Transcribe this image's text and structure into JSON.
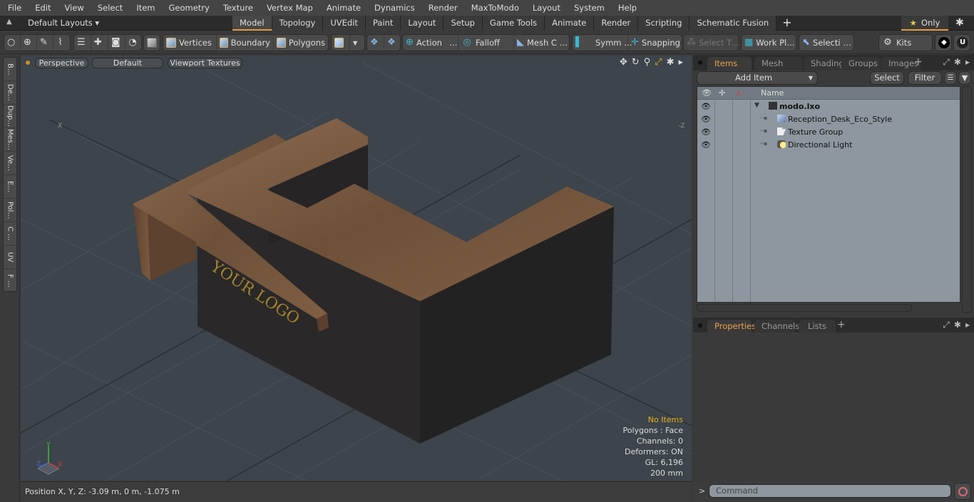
{
  "menu": [
    "File",
    "Edit",
    "View",
    "Select",
    "Item",
    "Geometry",
    "Texture",
    "Vertex Map",
    "Animate",
    "Dynamics",
    "Render",
    "MaxToModo",
    "Layout",
    "System",
    "Help"
  ],
  "layoutbar": {
    "layouts_label": "Default Layouts ▾",
    "tabs": [
      {
        "label": "Model",
        "active": true
      },
      {
        "label": "Topology"
      },
      {
        "label": "UVEdit"
      },
      {
        "label": "Paint"
      },
      {
        "label": "Layout"
      },
      {
        "label": "Setup"
      },
      {
        "label": "Game Tools"
      },
      {
        "label": "Animate"
      },
      {
        "label": "Render"
      },
      {
        "label": "Scripting"
      },
      {
        "label": "Schematic Fusion"
      }
    ],
    "add_tab": "+",
    "only_label": "Only"
  },
  "toolbar": {
    "vertices": "Vertices",
    "boundary": "Boundary",
    "polygons": "Polygons",
    "action": "Action",
    "action_more": "…",
    "falloff": "Falloff",
    "mesh": "Mesh C …",
    "symm": "Symm …",
    "snapping": "Snapping",
    "select_t": "Select T…",
    "workpl": "Work Pl…",
    "selecti": "Selecti …",
    "kits": "Kits"
  },
  "leftstrip": [
    "B…",
    "De…",
    "Dup…",
    "Mes…",
    "Ve…",
    "E…",
    "Pol…",
    "C …",
    "UV",
    "F …"
  ],
  "viewport": {
    "view": "Perspective",
    "shading": "Default",
    "textures": "Viewport Textures",
    "stats": {
      "no_items": "No Items",
      "polygons": "Polygons : Face",
      "channels": "Channels: 0",
      "deformers": "Deformers: ON",
      "gl": "GL: 6,196",
      "scale": "200 mm"
    },
    "axis": {
      "x": "X",
      "y": "Y",
      "z": "Z"
    },
    "logo_text": "YOUR LOGO"
  },
  "items_panel": {
    "tabs": [
      {
        "label": "Items",
        "active": true
      },
      {
        "label": "Mesh Ops"
      },
      {
        "label": "Shading"
      },
      {
        "label": "Groups"
      },
      {
        "label": "Images"
      }
    ],
    "add_item": "Add Item",
    "select": "Select",
    "filter": "Filter",
    "column_name": "Name",
    "rows": [
      {
        "name": "modo.lxo",
        "type": "scene"
      },
      {
        "name": "Reception_Desk_Eco_Style",
        "type": "mesh"
      },
      {
        "name": "Texture Group",
        "type": "texture-group"
      },
      {
        "name": "Directional Light",
        "type": "light"
      }
    ]
  },
  "properties_panel": {
    "tabs": [
      {
        "label": "Properties",
        "active": true
      },
      {
        "label": "Channels"
      },
      {
        "label": "Lists"
      }
    ]
  },
  "status": {
    "position": "Position X, Y, Z:   -3.09 m, 0 m, -1.075 m"
  },
  "command": {
    "placeholder": "Command",
    "prompt": ">"
  },
  "colors": {
    "accent": "#e39b3a",
    "highlight_text": "#e5b11a",
    "viewport_bg": "#3d444b",
    "tree_bg": "#8e979f"
  }
}
